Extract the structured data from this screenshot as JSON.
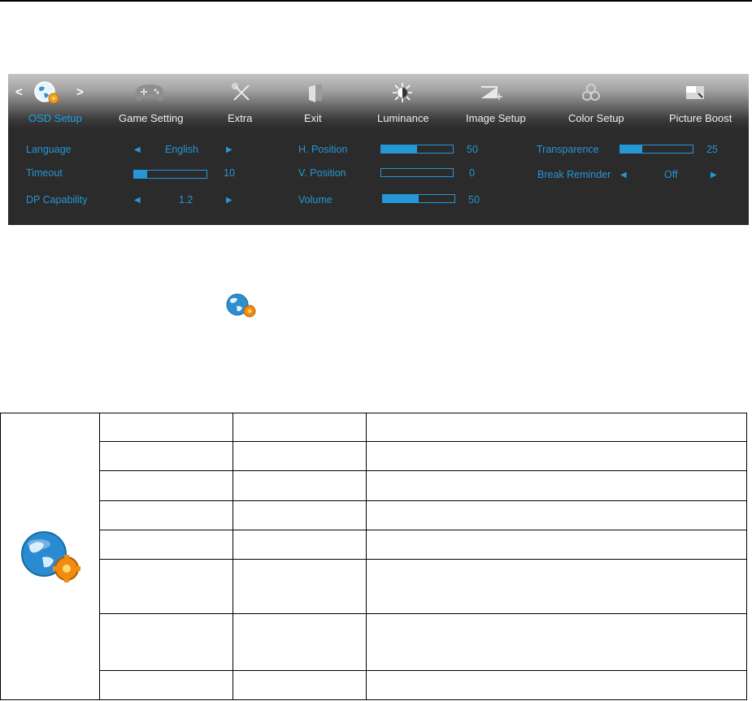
{
  "osd": {
    "tabs": [
      {
        "id": "osd-setup",
        "label": "OSD Setup",
        "active": true,
        "icon": "globe-gear-icon"
      },
      {
        "id": "game-setting",
        "label": "Game Setting",
        "active": false,
        "icon": "gamepad-icon"
      },
      {
        "id": "extra",
        "label": "Extra",
        "active": false,
        "icon": "tools-icon"
      },
      {
        "id": "exit",
        "label": "Exit",
        "active": false,
        "icon": "exit-door-icon"
      },
      {
        "id": "luminance",
        "label": "Luminance",
        "active": false,
        "icon": "sun-icon"
      },
      {
        "id": "image-setup",
        "label": "Image Setup",
        "active": false,
        "icon": "image-setup-icon"
      },
      {
        "id": "color-setup",
        "label": "Color Setup",
        "active": false,
        "icon": "color-circles-icon"
      },
      {
        "id": "picture-boost",
        "label": "Picture Boost",
        "active": false,
        "icon": "picture-boost-icon"
      }
    ],
    "settings": {
      "language": {
        "label": "Language",
        "value": "English"
      },
      "timeout": {
        "label": "Timeout",
        "value": "10",
        "level": 10
      },
      "dp_capability": {
        "label": "DP Capability",
        "value": "1.2"
      },
      "h_position": {
        "label": "H. Position",
        "value": "50",
        "level": 50
      },
      "v_position": {
        "label": "V. Position",
        "value": "0",
        "level": 0
      },
      "volume": {
        "label": "Volume",
        "value": "50",
        "level": 50
      },
      "transparence": {
        "label": "Transparence",
        "value": "25",
        "level": 25
      },
      "break_reminder": {
        "label": "Break Reminder",
        "value": "Off"
      }
    },
    "accent_color": "#2596d6"
  },
  "table": {
    "icon": "globe-gear-icon",
    "rows": 8
  }
}
